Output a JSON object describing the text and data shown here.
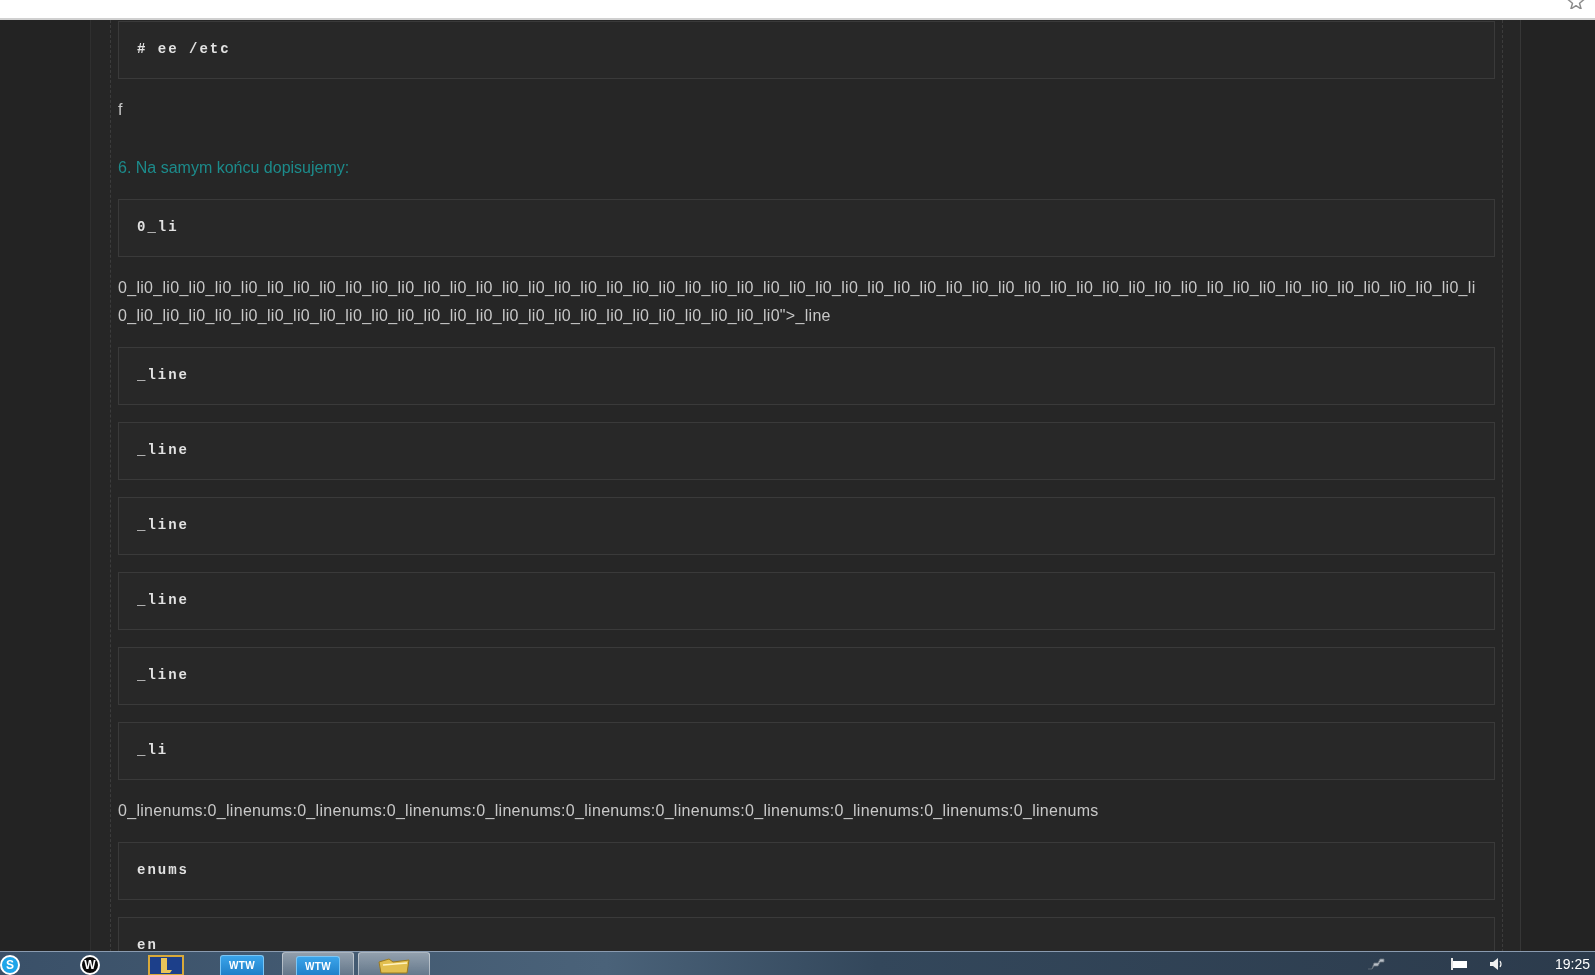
{
  "post": {
    "blocks": [
      {
        "kind": "code",
        "text": "# ee /etc"
      },
      {
        "kind": "text",
        "lines": [
          "f"
        ]
      },
      {
        "kind": "heading",
        "text": "6. Na samym końcu dopisujemy:"
      },
      {
        "kind": "code",
        "text": "0_li"
      },
      {
        "kind": "text",
        "lines": [
          "0_li0_li0_li0_li0_li0_li0_li0_li0_li0_li0_li0_li0_li0_li0_li0_li0_li0_li0_li0_li0_li0_li0_li0_li0_li0_li0_li0_li0_li0_li0_li0_li0_li0_li0_li0_li0_li0_li0_li0_li0_li0_li0_li0_li0_li0_li0_li0_li0_li0_li0_li0_li",
          "0_li0_li0_li0_li0_li0_li0_li0_li0_li0_li0_li0_li0_li0_li0_li0_li0_li0_li0_li0_li0_li0_li0_li0_li0_li0\">_line"
        ]
      },
      {
        "kind": "code",
        "text": "_line"
      },
      {
        "kind": "code",
        "text": "_line"
      },
      {
        "kind": "code",
        "text": "_line"
      },
      {
        "kind": "code",
        "text": "_line"
      },
      {
        "kind": "code",
        "text": "_line"
      },
      {
        "kind": "code",
        "text": "_li"
      },
      {
        "kind": "text",
        "lines": [
          "0_linenums:0_linenums:0_linenums:0_linenums:0_linenums:0_linenums:0_linenums:0_linenums:0_linenums:0_linenums:0_linenums"
        ]
      },
      {
        "kind": "code",
        "text": "enums"
      },
      {
        "kind": "code",
        "text": "en"
      }
    ]
  },
  "taskbar": {
    "buttons": [
      {
        "kind": "round-logo",
        "label": "S",
        "color": "#1ea5e9",
        "running": false
      },
      {
        "kind": "round-logo",
        "label": "W",
        "color": "#0a0a0a",
        "running": false
      },
      {
        "kind": "game",
        "running": false
      },
      {
        "kind": "tile",
        "label": "WTW",
        "running": false
      },
      {
        "kind": "tile",
        "label": "WTW",
        "running": true
      },
      {
        "kind": "folder",
        "running": true
      }
    ],
    "clock": "19:25"
  }
}
